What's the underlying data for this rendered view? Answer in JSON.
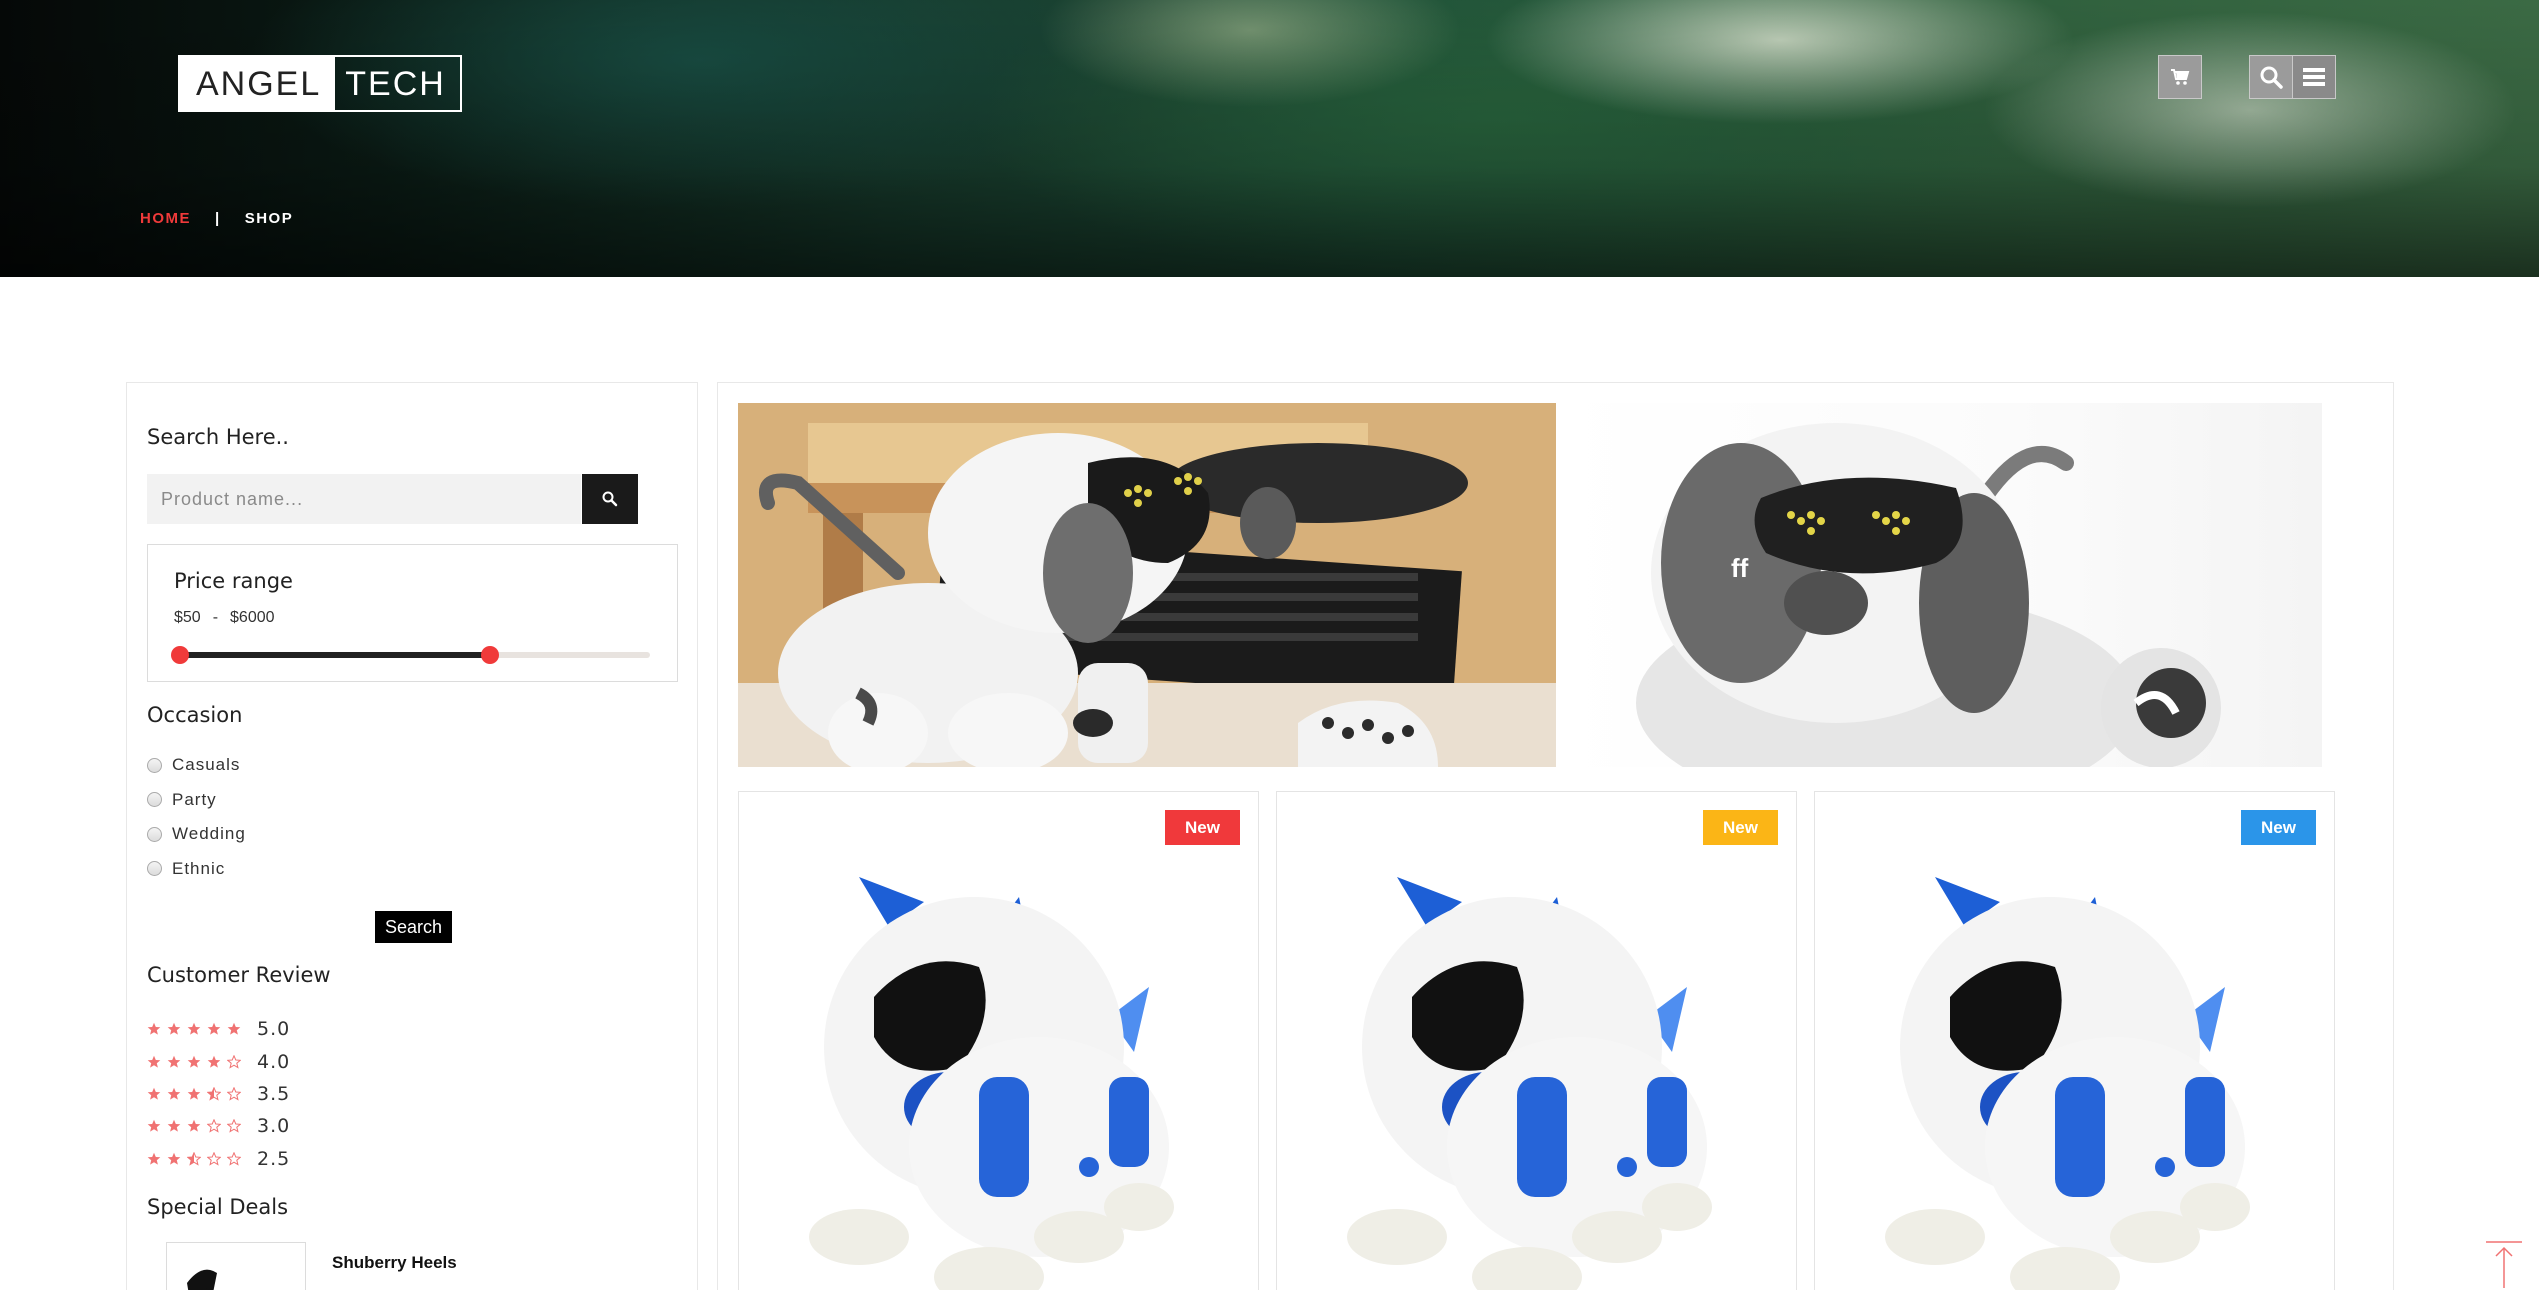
{
  "header": {
    "logo_left": "ANGEL",
    "logo_right": "TECH",
    "cart_icon": "cart-icon",
    "search_icon": "search-icon",
    "menu_icon": "hamburger-menu-icon"
  },
  "breadcrumb": {
    "home": "HOME",
    "separator": "|",
    "current": "SHOP"
  },
  "sidebar": {
    "search": {
      "title": "Search Here..",
      "placeholder": "Product name...",
      "button_icon": "search-icon"
    },
    "price": {
      "title": "Price range",
      "min_label": "$50",
      "separator": "-",
      "max_label": "$6000",
      "slider_min_fraction": 0.0,
      "slider_max_fraction": 0.66
    },
    "occasion": {
      "title": "Occasion",
      "options": [
        "Casuals",
        "Party",
        "Wedding",
        "Ethnic"
      ],
      "button_label": "Search"
    },
    "review": {
      "title": "Customer Review",
      "items": [
        {
          "rating": "5.0",
          "stars": 5
        },
        {
          "rating": "4.0",
          "stars": 4
        },
        {
          "rating": "3.5",
          "stars": 3.5
        },
        {
          "rating": "3.0",
          "stars": 3
        },
        {
          "rating": "2.5",
          "stars": 2.5
        }
      ]
    },
    "deals": {
      "title": "Special Deals",
      "items": [
        {
          "name": "Shuberry Heels"
        }
      ]
    }
  },
  "banner": {
    "overlay_text": "ff"
  },
  "products": [
    {
      "badge": "New",
      "badge_color": "#f0393b"
    },
    {
      "badge": "New",
      "badge_color": "#fbb516"
    },
    {
      "badge": "New",
      "badge_color": "#2b95e9"
    }
  ],
  "colors": {
    "accent_red": "#f03a3a",
    "star_color": "#f07272"
  }
}
